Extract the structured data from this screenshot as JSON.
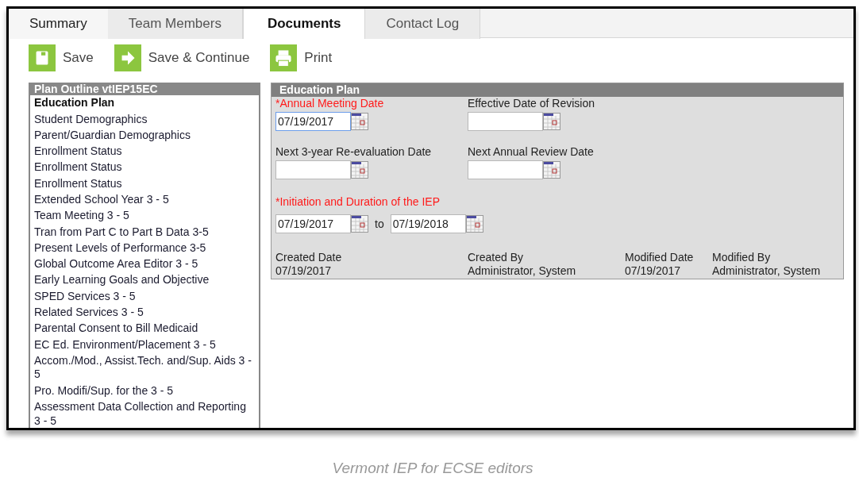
{
  "tabs": [
    {
      "label": "Summary",
      "selected": false
    },
    {
      "label": "Team Members",
      "selected": false
    },
    {
      "label": "Documents",
      "selected": true
    },
    {
      "label": "Contact Log",
      "selected": false
    }
  ],
  "toolbar": [
    {
      "label": "Save",
      "kind": "save"
    },
    {
      "label": "Save & Continue",
      "kind": "continue"
    },
    {
      "label": "Print",
      "kind": "print"
    }
  ],
  "outline": {
    "title": "Plan Outline vtIEP15EC",
    "items": [
      {
        "label": "Education Plan",
        "selected": true
      },
      {
        "label": "Student Demographics",
        "selected": false
      },
      {
        "label": "Parent/Guardian Demographics",
        "selected": false
      },
      {
        "label": "Enrollment Status",
        "selected": false
      },
      {
        "label": "Enrollment Status",
        "selected": false
      },
      {
        "label": "Enrollment Status",
        "selected": false
      },
      {
        "label": "Extended School Year 3 - 5",
        "selected": false
      },
      {
        "label": "Team Meeting 3 - 5",
        "selected": false
      },
      {
        "label": "Tran from Part C to Part B Data 3-5",
        "selected": false
      },
      {
        "label": "Present Levels of Performance 3-5",
        "selected": false
      },
      {
        "label": "Global Outcome Area Editor 3 - 5",
        "selected": false
      },
      {
        "label": "Early Learning Goals and Objective",
        "selected": false
      },
      {
        "label": "SPED Services 3 - 5",
        "selected": false
      },
      {
        "label": "Related Services 3 - 5",
        "selected": false
      },
      {
        "label": "Parental Consent to Bill Medicaid",
        "selected": false
      },
      {
        "label": "EC Ed. Environment/Placement 3 - 5",
        "selected": false
      },
      {
        "label": "Accom./Mod., Assist.Tech. and/Sup. Aids 3 - 5",
        "selected": false
      },
      {
        "label": "Pro. Modifi/Sup. for the 3 - 5",
        "selected": false
      },
      {
        "label": "Assessment Data Collection and Reporting 3 - 5",
        "selected": false
      }
    ]
  },
  "editor": {
    "title": "Education Plan",
    "date_fields": [
      {
        "label": "*Annual Meeting Date",
        "required": true,
        "value": "07/19/2017",
        "focused": true
      },
      {
        "label": "Effective Date of Revision",
        "required": false,
        "focused": false
      },
      {
        "label": "Next 3-year Re-evaluation Date",
        "required": false,
        "focused": false
      },
      {
        "label": "Next Annual Review Date",
        "required": false,
        "focused": false
      }
    ],
    "duration": {
      "label": "*Initiation and Duration of the IEP",
      "required": true,
      "start": "07/19/2017",
      "separator": "to",
      "end": "07/19/2018"
    },
    "audit": [
      {
        "label": "Created Date",
        "value": "07/19/2017"
      },
      {
        "label": "Created By",
        "value": "Administrator, System"
      },
      {
        "label": "Modified Date",
        "value": "07/19/2017"
      },
      {
        "label": "Modified By",
        "value": "Administrator, System"
      }
    ]
  },
  "caption": "Vermont IEP for ECSE editors"
}
